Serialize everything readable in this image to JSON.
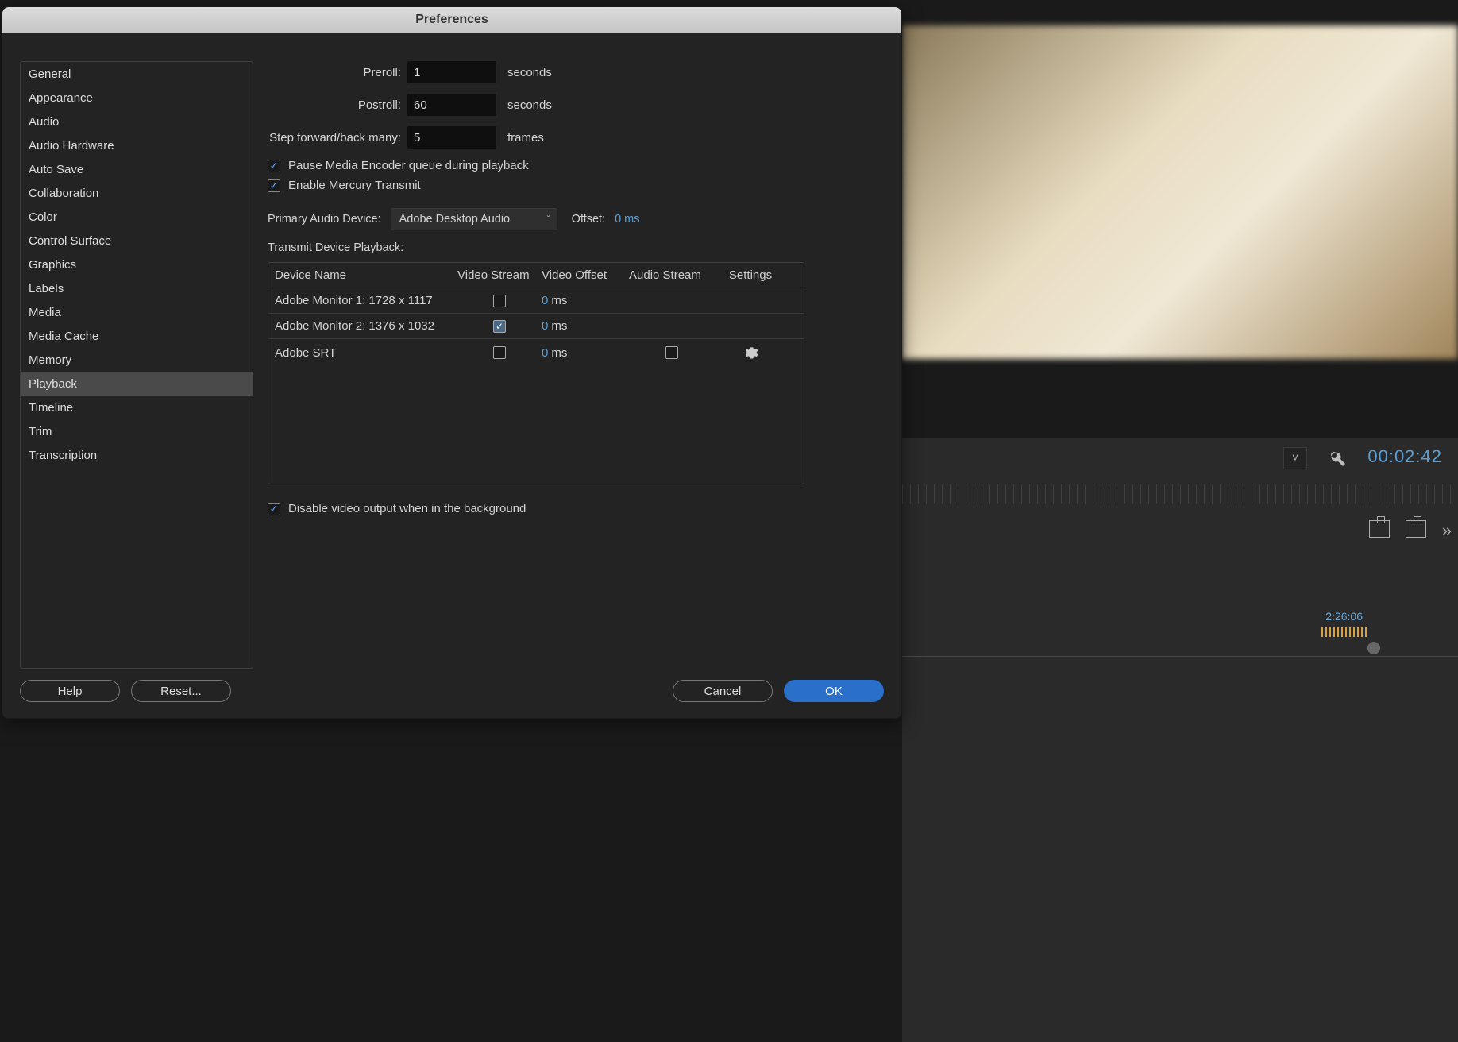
{
  "dialog": {
    "title": "Preferences",
    "sidebar": {
      "items": [
        "General",
        "Appearance",
        "Audio",
        "Audio Hardware",
        "Auto Save",
        "Collaboration",
        "Color",
        "Control Surface",
        "Graphics",
        "Labels",
        "Media",
        "Media Cache",
        "Memory",
        "Playback",
        "Timeline",
        "Trim",
        "Transcription"
      ],
      "selected_index": 13
    },
    "playback": {
      "preroll_label": "Preroll:",
      "preroll_value": "1",
      "preroll_unit": "seconds",
      "postroll_label": "Postroll:",
      "postroll_value": "60",
      "postroll_unit": "seconds",
      "step_label": "Step forward/back many:",
      "step_value": "5",
      "step_unit": "frames",
      "pause_encoder_label": "Pause Media Encoder queue during playback",
      "pause_encoder_checked": true,
      "mercury_label": "Enable Mercury Transmit",
      "mercury_checked": true,
      "primary_audio_label": "Primary Audio Device:",
      "primary_audio_value": "Adobe Desktop Audio",
      "offset_label": "Offset:",
      "offset_value": "0 ms",
      "transmit_label": "Transmit Device Playback:",
      "table": {
        "headers": {
          "device": "Device Name",
          "video_stream": "Video Stream",
          "video_offset": "Video Offset",
          "audio_stream": "Audio Stream",
          "settings": "Settings"
        },
        "rows": [
          {
            "name": "Adobe Monitor 1: 1728 x 1117",
            "video_stream_checked": false,
            "offset_num": "0",
            "offset_unit": "ms",
            "has_audio": false,
            "has_settings": false
          },
          {
            "name": "Adobe Monitor 2: 1376 x 1032",
            "video_stream_checked": true,
            "offset_num": "0",
            "offset_unit": "ms",
            "has_audio": false,
            "has_settings": false
          },
          {
            "name": "Adobe SRT",
            "video_stream_checked": false,
            "offset_num": "0",
            "offset_unit": "ms",
            "has_audio": true,
            "audio_stream_checked": false,
            "has_settings": true
          }
        ]
      },
      "disable_output_label": "Disable video output when in the background",
      "disable_output_checked": true
    },
    "buttons": {
      "help": "Help",
      "reset": "Reset...",
      "cancel": "Cancel",
      "ok": "OK"
    }
  },
  "background": {
    "timecode_main": "00:02:42",
    "timecode_small": "2:26:06"
  }
}
